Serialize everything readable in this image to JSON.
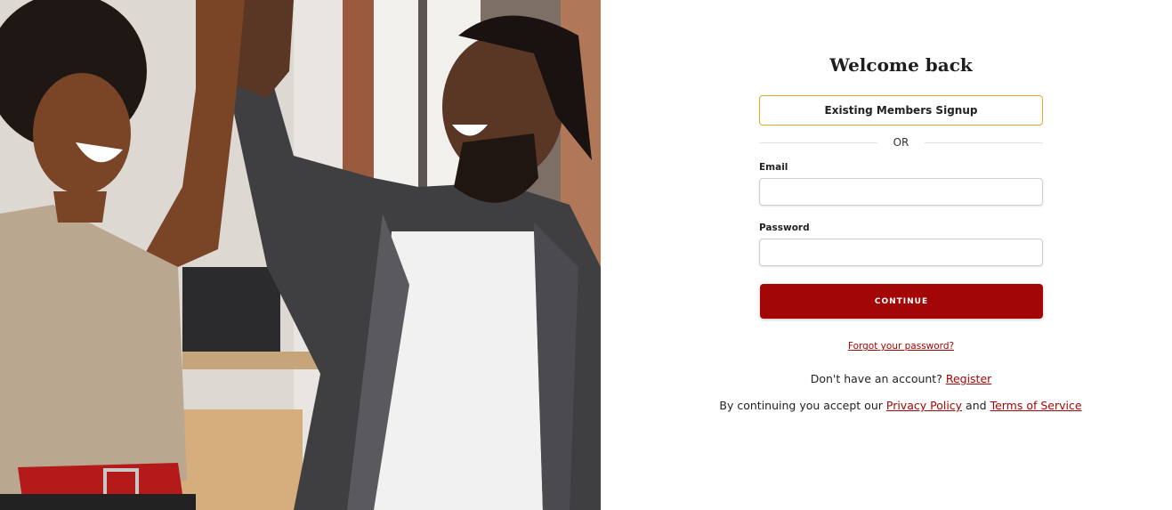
{
  "hero": {
    "image_icon": "people-high-five-photo"
  },
  "login": {
    "title": "Welcome back",
    "members_signup_label": "Existing Members Signup",
    "divider_text": "OR",
    "email_label": "Email",
    "email_value": "",
    "password_label": "Password",
    "password_value": "",
    "continue_label": "CONTINUE",
    "forgot_password_link": "Forgot your password?",
    "no_account_text": "Don't have an account?",
    "register_link": "Register",
    "terms_prefix": "By continuing you accept our",
    "privacy_link": "Privacy Policy",
    "and_text": "and",
    "terms_link": "Terms of Service"
  },
  "colors": {
    "accent": "#a30606",
    "members_border": "#dcab2a"
  }
}
